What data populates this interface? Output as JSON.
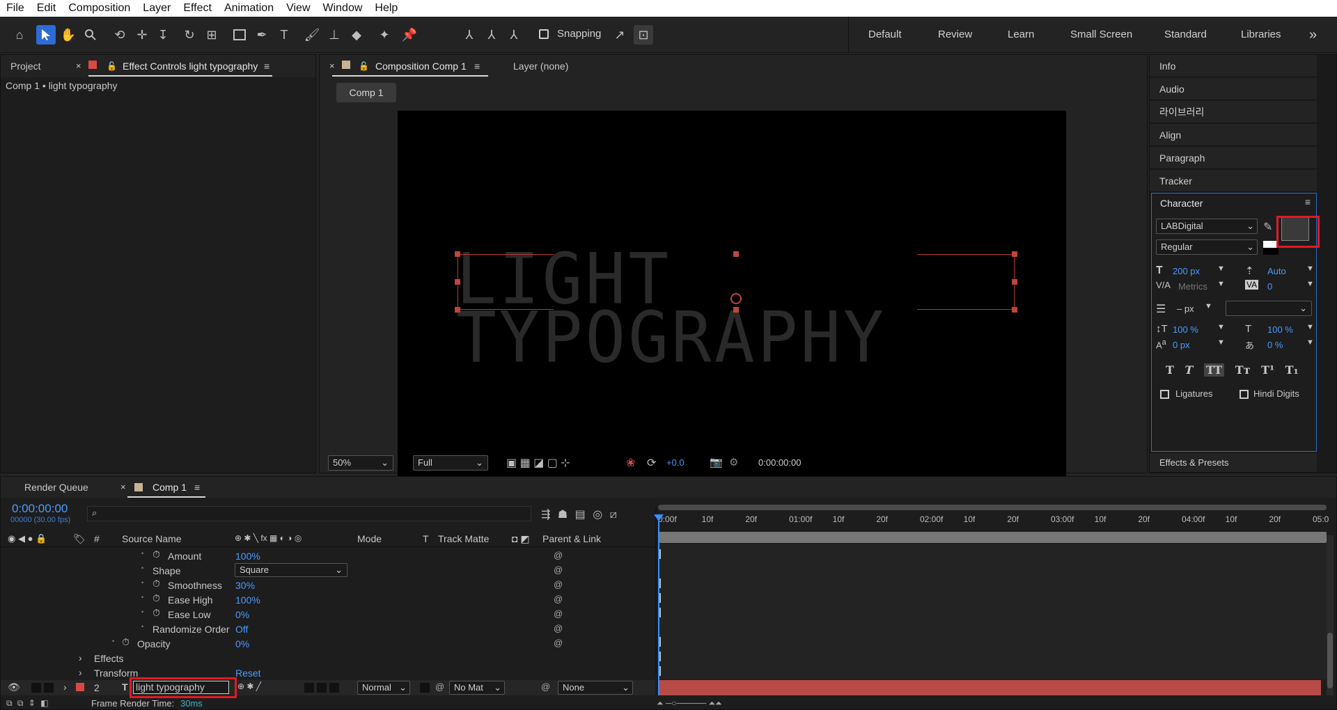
{
  "menu": [
    "File",
    "Edit",
    "Composition",
    "Layer",
    "Effect",
    "Animation",
    "View",
    "Window",
    "Help"
  ],
  "toolbar": {
    "snapping_label": "Snapping",
    "workspaces": [
      "Default",
      "Review",
      "Learn",
      "Small Screen",
      "Standard",
      "Libraries"
    ],
    "more": "»"
  },
  "left_panel": {
    "tab_project": "Project",
    "tab_effect_controls": "Effect Controls light typography",
    "subtitle": "Comp 1 • light typography"
  },
  "comp_panel": {
    "tab_composition": "Composition Comp 1",
    "tab_layer": "Layer (none)",
    "comp_button": "Comp 1",
    "viewer_text": "LIGHT TYPOGRAPHY",
    "zoom": "50%",
    "resolution": "Full",
    "exposure": "+0.0",
    "timecode": "0:00:00:00"
  },
  "right_panels": [
    "Info",
    "Audio",
    "라이브러리",
    "Align",
    "Paragraph",
    "Tracker"
  ],
  "character": {
    "title": "Character",
    "font": "LABDigital",
    "style": "Regular",
    "size": "200 px",
    "leading": "Auto",
    "kerning": "Metrics",
    "tracking": "0",
    "stroke": "– px",
    "vscale": "100 %",
    "hscale": "100 %",
    "baseline": "0 px",
    "tsume": "0 %",
    "ligatures": "Ligatures",
    "hindi": "Hindi Digits",
    "fill_color": "#3a3a3a"
  },
  "effects_presets": "Effects & Presets",
  "timeline": {
    "tab_render": "Render Queue",
    "tab_comp": "Comp 1",
    "timecode": "0:00:00:00",
    "fps": "00000 (30.00 fps)",
    "headers": {
      "num": "#",
      "source": "Source Name",
      "mode": "Mode",
      "t": "T",
      "track": "Track Matte",
      "parent": "Parent & Link"
    },
    "ruler": [
      "0:00f",
      "10f",
      "20f",
      "01:00f",
      "10f",
      "20f",
      "02:00f",
      "10f",
      "20f",
      "03:00f",
      "10f",
      "20f",
      "04:00f",
      "10f",
      "20f",
      "05:0"
    ],
    "props": [
      {
        "label": "Amount",
        "value": "100%"
      },
      {
        "label": "Shape",
        "value": "Square"
      },
      {
        "label": "Smoothness",
        "value": "30%"
      },
      {
        "label": "Ease High",
        "value": "100%"
      },
      {
        "label": "Ease Low",
        "value": "0%"
      },
      {
        "label": "Randomize Order",
        "value": "Off"
      },
      {
        "label": "Opacity",
        "value": "0%"
      }
    ],
    "effects": "Effects",
    "transform": "Transform",
    "transform_reset": "Reset",
    "layer": {
      "num": "2",
      "name": "light typography",
      "mode": "Normal",
      "matte": "No Mat",
      "parent": "None"
    },
    "render_time_label": "Frame Render Time:",
    "render_time_value": "30ms"
  }
}
